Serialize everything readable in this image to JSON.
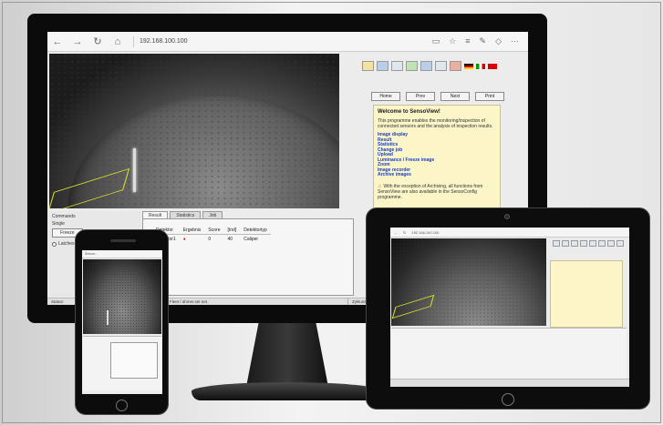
{
  "browser": {
    "address": "192.168.100.100",
    "nav_icons": [
      "back-icon",
      "forward-icon",
      "refresh-icon",
      "home-icon"
    ],
    "right_icons": [
      "reading-view-icon",
      "favorite-star-icon",
      "hub-icon",
      "notes-icon",
      "share-icon",
      "more-icon"
    ]
  },
  "app": {
    "toolbar_icons": [
      "sensor-icon",
      "chat-icon",
      "list-icon",
      "green-panel-icon",
      "monitor-icon",
      "settings-icon",
      "camera-icon",
      "flag-de-icon",
      "flag-it-icon",
      "flag-other-icon"
    ],
    "nav_buttons": [
      "Home",
      "Prev",
      "Next",
      "Print"
    ],
    "welcome": {
      "title": "Welcome to SensoView!",
      "intro": "This programme enables the monitoring/inspection of connected sensors and the analysis of inspection results.",
      "links": [
        "Image display",
        "Result",
        "Statistics",
        "Change job",
        "Upload",
        "Luminance / Freeze image",
        "Zoom",
        "Image recorder",
        "Archive images"
      ],
      "note": "With the exception of Archiving, all functions from SensoView are also available in the SensoConfig programme."
    },
    "left_panel": {
      "header": "Commands",
      "mode": "Single",
      "freeze_label": "Freeze",
      "radio_label": "Latches"
    },
    "tabs": [
      "Result",
      "Statistics",
      "Job"
    ],
    "result_table": {
      "headers": [
        "Detektor",
        "Ergebnis",
        "Score",
        "[Ind]",
        "Detektortyp"
      ],
      "rows": [
        {
          "detector": "Detector1",
          "result": "●",
          "score": "0",
          "ind": "40",
          "type": "Caliper"
        }
      ]
    },
    "statusbar": {
      "left": "Status:",
      "middle": "Fleet / ahmer.ser.net.",
      "right": "Zykluszeit: 40 ms"
    }
  },
  "tablet": {
    "address": "192.168.100.100"
  },
  "phone": {
    "address": "Sensor..."
  }
}
